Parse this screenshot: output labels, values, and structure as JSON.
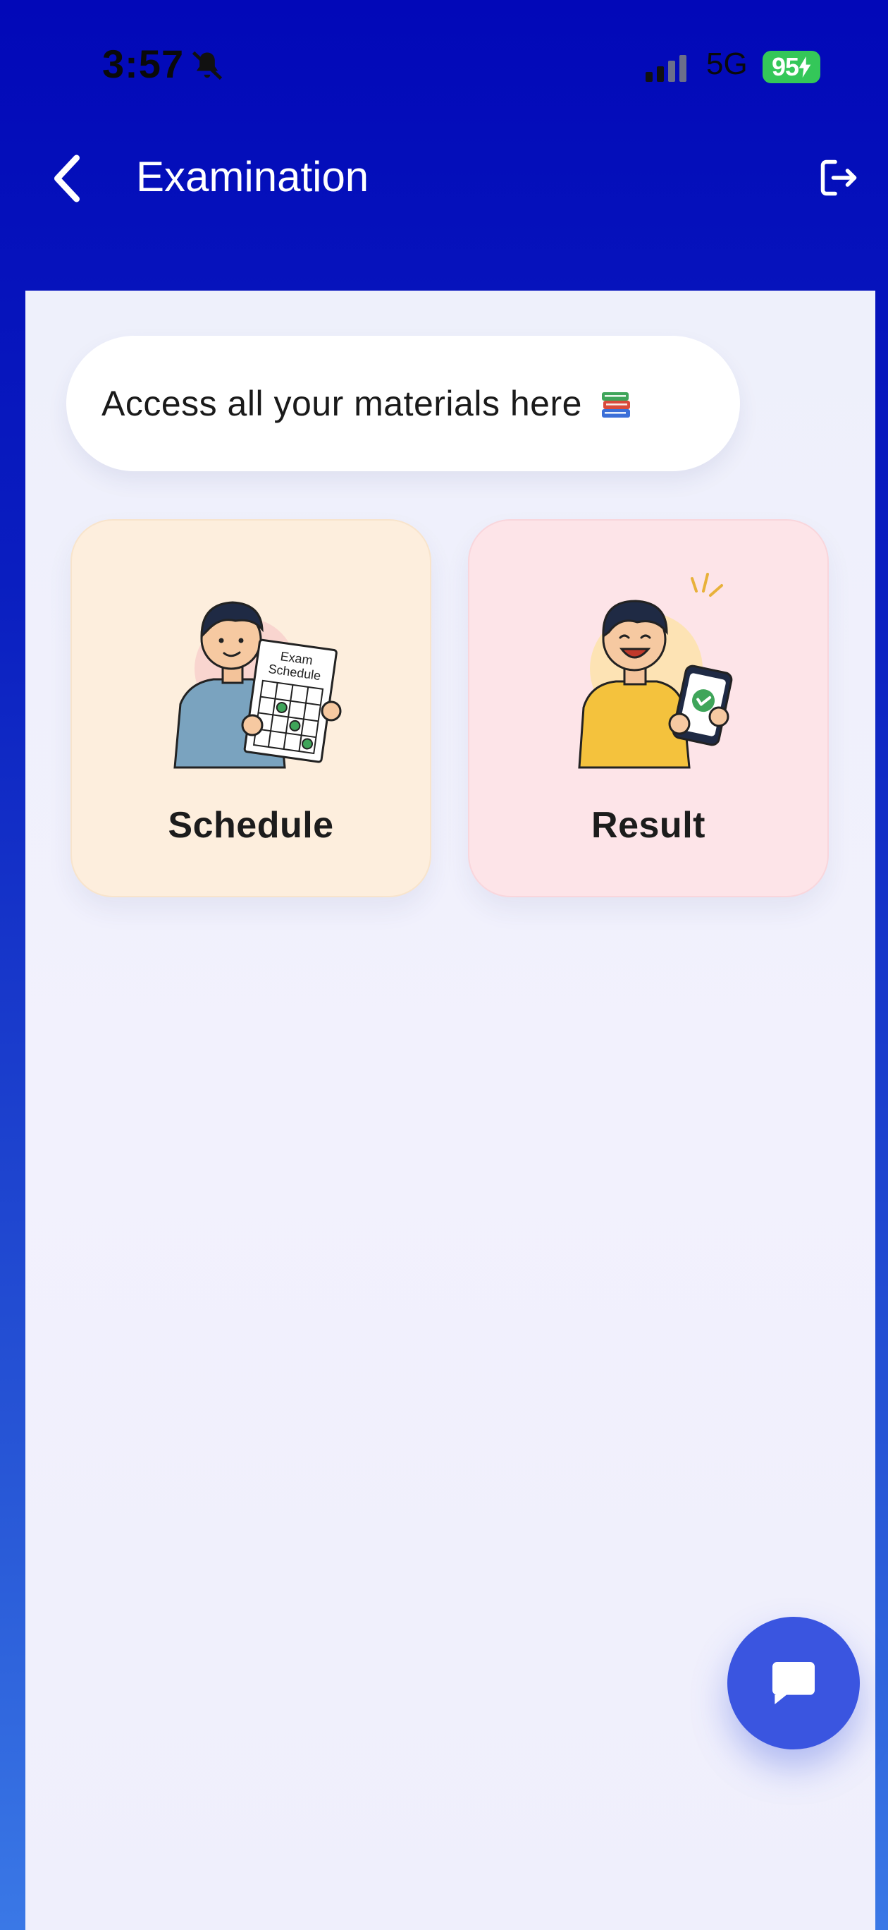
{
  "status_bar": {
    "time": "3:57",
    "network": "5G",
    "battery": "95"
  },
  "header": {
    "title": "Examination",
    "back_icon": "chevron-left-icon",
    "logout_icon": "logout-icon"
  },
  "banner": {
    "text": "Access all your materials here",
    "icon": "books-emoji"
  },
  "cards": [
    {
      "label": "Schedule",
      "illustration": "student-holding-exam-schedule",
      "illustration_text_1": "Exam",
      "illustration_text_2": "Schedule",
      "background": "#fdeedd"
    },
    {
      "label": "Result",
      "illustration": "student-checking-phone-result",
      "background": "#fde4e8"
    }
  ],
  "fab": {
    "icon": "chat-bubble-icon",
    "color": "#3a55e0"
  },
  "colors": {
    "header_background": "#0208b8",
    "content_background": "#eef0fb",
    "battery": "#34c759"
  }
}
